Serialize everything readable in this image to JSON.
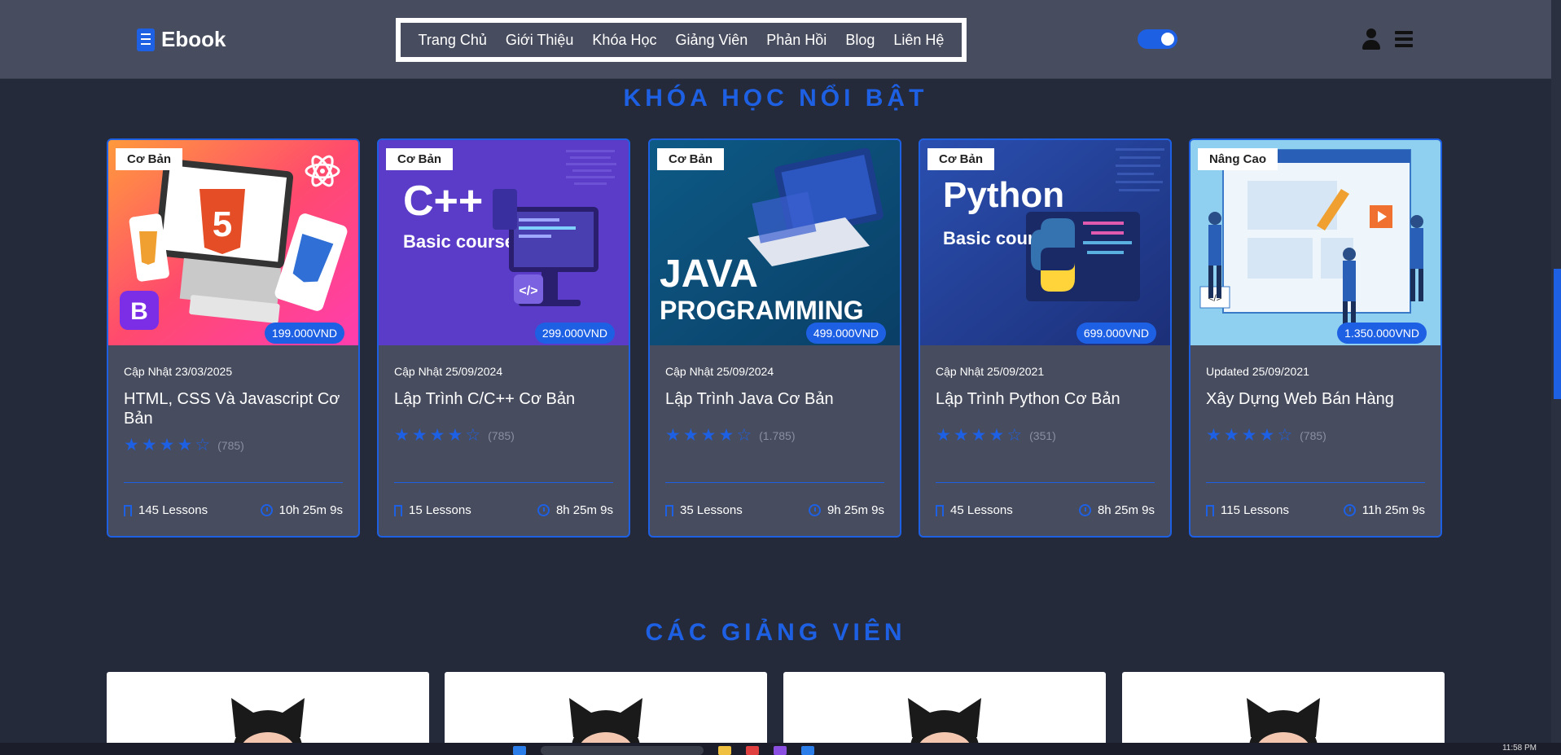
{
  "header": {
    "logo_text": "Ebook",
    "nav": [
      "Trang Chủ",
      "Giới Thiệu",
      "Khóa Học",
      "Giảng Viên",
      "Phản Hồi",
      "Blog",
      "Liên Hệ"
    ]
  },
  "featured": {
    "title": "KHÓA HỌC NỔI BẬT",
    "courses": [
      {
        "level": "Cơ Bản",
        "price": "199.000VND",
        "updated": "Cập Nhật 23/03/2025",
        "title": "HTML, CSS Và Javascript Cơ Bản",
        "rating": 4.5,
        "reviews": "(785)",
        "lessons": "145 Lessons",
        "duration": "10h 25m 9s"
      },
      {
        "level": "Cơ Bản",
        "price": "299.000VND",
        "updated": "Cập Nhật 25/09/2024",
        "title": "Lập Trình C/C++ Cơ Bản",
        "rating": 4.5,
        "reviews": "(785)",
        "lessons": "15 Lessons",
        "duration": "8h 25m 9s",
        "thumb_title": "C++",
        "thumb_sub": "Basic course"
      },
      {
        "level": "Cơ Bản",
        "price": "499.000VND",
        "updated": "Cập Nhật 25/09/2024",
        "title": "Lập Trình Java Cơ Bản",
        "rating": 4.5,
        "reviews": "(1.785)",
        "lessons": "35 Lessons",
        "duration": "9h 25m 9s",
        "thumb_title": "JAVA",
        "thumb_sub": "PROGRAMMING"
      },
      {
        "level": "Cơ Bản",
        "price": "699.000VND",
        "updated": "Cập Nhật 25/09/2021",
        "title": "Lập Trình Python Cơ Bản",
        "rating": 4.5,
        "reviews": "(351)",
        "lessons": "45 Lessons",
        "duration": "8h 25m 9s",
        "thumb_title": "Python",
        "thumb_sub": "Basic course"
      },
      {
        "level": "Nâng Cao",
        "price": "1.350.000VND",
        "updated": "Updated 25/09/2021",
        "title": "Xây Dựng Web Bán Hàng",
        "rating": 4.5,
        "reviews": "(785)",
        "lessons": "115 Lessons",
        "duration": "11h 25m 9s"
      }
    ]
  },
  "instructors": {
    "title": "CÁC GIẢNG VIÊN",
    "count": 4
  },
  "taskbar": {
    "clock": "11:58 PM"
  },
  "colors": {
    "accent": "#1e60e4",
    "background": "#252a3a",
    "card": "#474c5e"
  }
}
